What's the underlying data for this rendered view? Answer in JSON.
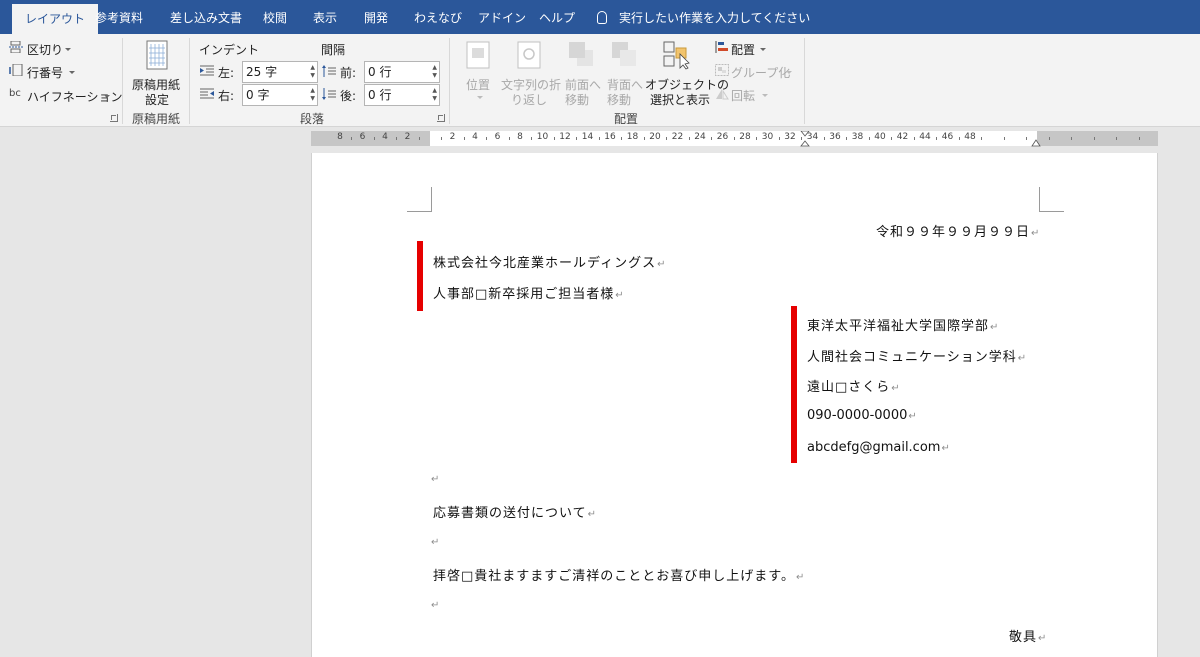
{
  "tabs": [
    {
      "label": "レイアウト",
      "active": true
    },
    {
      "label": "参考資料",
      "active": false
    },
    {
      "label": "差し込み文書",
      "active": false
    },
    {
      "label": "校閲",
      "active": false
    },
    {
      "label": "表示",
      "active": false
    },
    {
      "label": "開発",
      "active": false
    },
    {
      "label": "わえなび",
      "active": false
    },
    {
      "label": "アドイン",
      "active": false
    },
    {
      "label": "ヘルプ",
      "active": false
    }
  ],
  "tell_me": "実行したい作業を入力してください",
  "ribbon": {
    "page_setup": {
      "breaks": "区切り",
      "line_numbers": "行番号",
      "hyphenation": "ハイフネーション"
    },
    "genko": {
      "button_line1": "原稿用紙",
      "button_line2": "設定",
      "group_label": "原稿用紙"
    },
    "paragraph": {
      "indent_label": "インデント",
      "spacing_label": "間隔",
      "left_label": "左:",
      "left_value": "25 字",
      "right_label": "右:",
      "right_value": "0 字",
      "before_label": "前:",
      "before_value": "0 行",
      "after_label": "後:",
      "after_value": "0 行",
      "group_label": "段落"
    },
    "arrange": {
      "position": "位置",
      "wrap_line1": "文字列の折",
      "wrap_line2": "り返し",
      "forward_line1": "前面へ",
      "forward_line2": "移動",
      "backward_line1": "背面へ",
      "backward_line2": "移動",
      "selection_line1": "オブジェクトの",
      "selection_line2": "選択と表示",
      "align": "配置",
      "group": "グループ化",
      "rotate": "回転",
      "group_label": "配置"
    }
  },
  "ruler": {
    "left_numbers": [
      "8",
      "6",
      "4",
      "2"
    ],
    "right_numbers": [
      "2",
      "4",
      "6",
      "8",
      "10",
      "12",
      "14",
      "16",
      "18",
      "20",
      "22",
      "24",
      "26",
      "28",
      "30",
      "32",
      "34",
      "36",
      "38",
      "40",
      "42",
      "44",
      "46",
      "48"
    ]
  },
  "document": {
    "date": "令和９９年９９月９９日",
    "recipient_company": "株式会社今北産業ホールディングス",
    "recipient_dept": "人事部□新卒採用ご担当者様",
    "sender_university": "東洋太平洋福祉大学国際学部",
    "sender_department": "人間社会コミュニケーション学科",
    "sender_name": "遠山□さくら",
    "sender_phone": "090-0000-0000",
    "sender_email": "abcdefg@gmail.com",
    "subject": "応募書類の送付について",
    "greeting": "拝啓□貴社ますますご清祥のこととお喜び申し上げます。",
    "closing": "敬具",
    "paragraph_mark": "↵"
  },
  "colors": {
    "tab_bar": "#2b579a",
    "ribbon_bg": "#f3f3f3",
    "highlight_bar": "#e60000"
  }
}
